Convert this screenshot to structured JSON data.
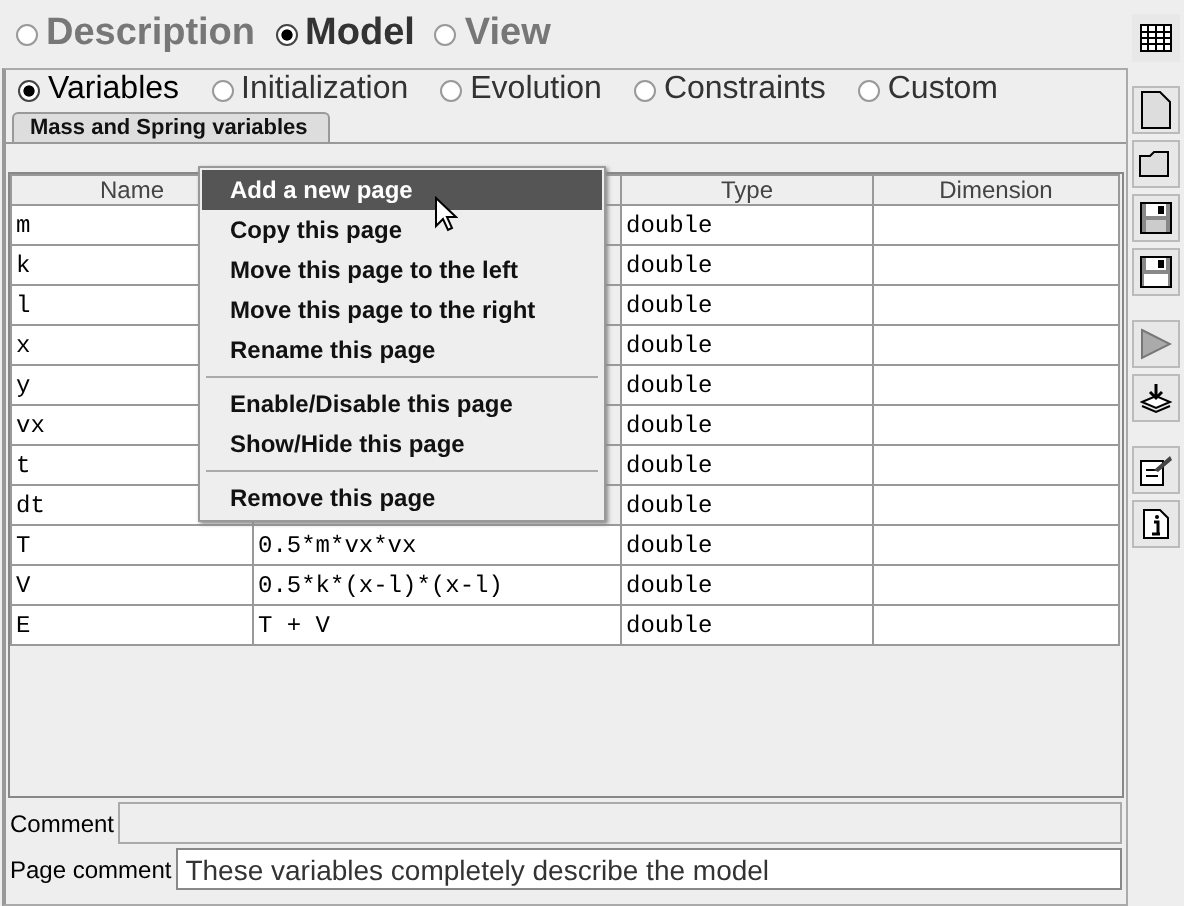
{
  "top_tabs": [
    {
      "label": "Description",
      "selected": false
    },
    {
      "label": "Model",
      "selected": true
    },
    {
      "label": "View",
      "selected": false
    }
  ],
  "sub_tabs": [
    {
      "label": "Variables",
      "selected": true
    },
    {
      "label": "Initialization",
      "selected": false
    },
    {
      "label": "Evolution",
      "selected": false
    },
    {
      "label": "Constraints",
      "selected": false
    },
    {
      "label": "Custom",
      "selected": false
    }
  ],
  "page_tabs": [
    {
      "label": "Mass and Spring variables",
      "selected": true
    }
  ],
  "table": {
    "headers": {
      "name": "Name",
      "type": "Type",
      "dimension": "Dimension"
    },
    "rows": [
      {
        "name": "m",
        "type": "double"
      },
      {
        "name": "k",
        "type": "double"
      },
      {
        "name": "l",
        "type": "double"
      },
      {
        "name": "x",
        "type": "double"
      },
      {
        "name": "y",
        "type": "double"
      },
      {
        "name": "vx",
        "type": "double"
      },
      {
        "name": "t",
        "type": "double"
      },
      {
        "name": "dt",
        "type": "double"
      },
      {
        "name": "T",
        "value": "0.5*m*vx*vx",
        "type": "double"
      },
      {
        "name": "V",
        "value": "0.5*k*(x-l)*(x-l)",
        "type": "double"
      },
      {
        "name": "E",
        "value": "T + V",
        "type": "double"
      }
    ]
  },
  "context_menu": {
    "items": [
      {
        "kind": "item",
        "label": "Add a new page",
        "selected": true
      },
      {
        "kind": "item",
        "label": "Copy this page",
        "selected": false
      },
      {
        "kind": "item",
        "label": "Move this page to the left",
        "selected": false
      },
      {
        "kind": "item",
        "label": "Move this page to the right",
        "selected": false
      },
      {
        "kind": "item",
        "label": "Rename this page",
        "selected": false
      },
      {
        "kind": "separator"
      },
      {
        "kind": "item",
        "label": "Enable/Disable this page",
        "selected": false
      },
      {
        "kind": "item",
        "label": "Show/Hide this page",
        "selected": false
      },
      {
        "kind": "separator"
      },
      {
        "kind": "item",
        "label": "Remove this page",
        "selected": false
      }
    ]
  },
  "comment": {
    "label": "Comment"
  },
  "page_comment": {
    "label": "Page comment",
    "value": "These variables completely describe the model"
  }
}
